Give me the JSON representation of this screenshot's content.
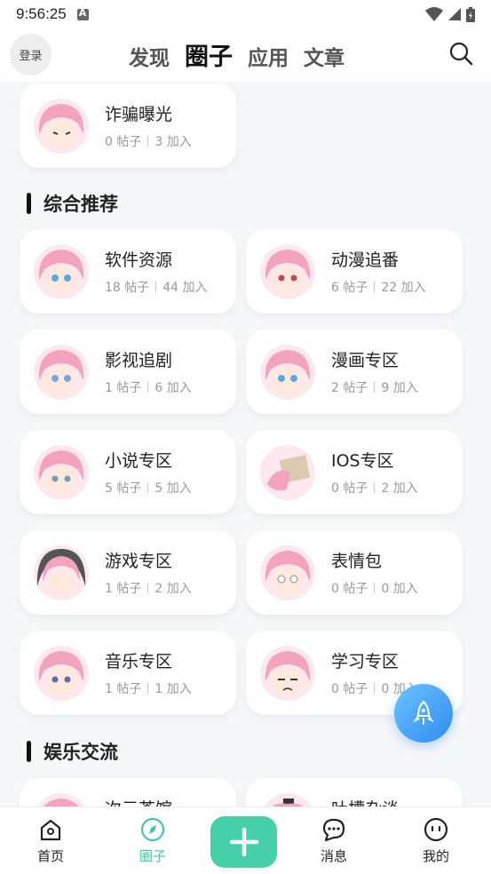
{
  "status_bar": {
    "time": "9:56:25"
  },
  "header": {
    "login_label": "登录",
    "tabs": [
      {
        "label": "发现"
      },
      {
        "label": "圈子"
      },
      {
        "label": "应用"
      },
      {
        "label": "文章"
      }
    ],
    "active_tab": "圈子"
  },
  "top_card": {
    "name": "诈骗曝光",
    "posts": "0 帖子",
    "members": "3 加入"
  },
  "sections": [
    {
      "title": "综合推荐",
      "cards": [
        {
          "name": "软件资源",
          "posts": "18 帖子",
          "members": "44 加入"
        },
        {
          "name": "动漫追番",
          "posts": "6 帖子",
          "members": "22 加入"
        },
        {
          "name": "影视追剧",
          "posts": "1 帖子",
          "members": "6 加入"
        },
        {
          "name": "漫画专区",
          "posts": "2 帖子",
          "members": "9 加入"
        },
        {
          "name": "小说专区",
          "posts": "5 帖子",
          "members": "5 加入"
        },
        {
          "name": "IOS专区",
          "posts": "0 帖子",
          "members": "2 加入"
        },
        {
          "name": "游戏专区",
          "posts": "1 帖子",
          "members": "2 加入"
        },
        {
          "name": "表情包",
          "posts": "0 帖子",
          "members": "0 加入"
        },
        {
          "name": "音乐专区",
          "posts": "1 帖子",
          "members": "1 加入"
        },
        {
          "name": "学习专区",
          "posts": "0 帖子",
          "members": "0 加入"
        }
      ]
    },
    {
      "title": "娱乐交流",
      "cards": [
        {
          "name": "次元茶馆"
        },
        {
          "name": "吐槽杂谈"
        }
      ]
    }
  ],
  "bottom_nav": {
    "items": [
      {
        "label": "首页"
      },
      {
        "label": "圈子"
      },
      {
        "label": "消息"
      },
      {
        "label": "我的"
      }
    ]
  },
  "colors": {
    "accent": "#45d0a8",
    "active_nav": "#3ec9a0",
    "fab": "#2f8cf0",
    "avatar_hair": "#f3a3bd"
  }
}
